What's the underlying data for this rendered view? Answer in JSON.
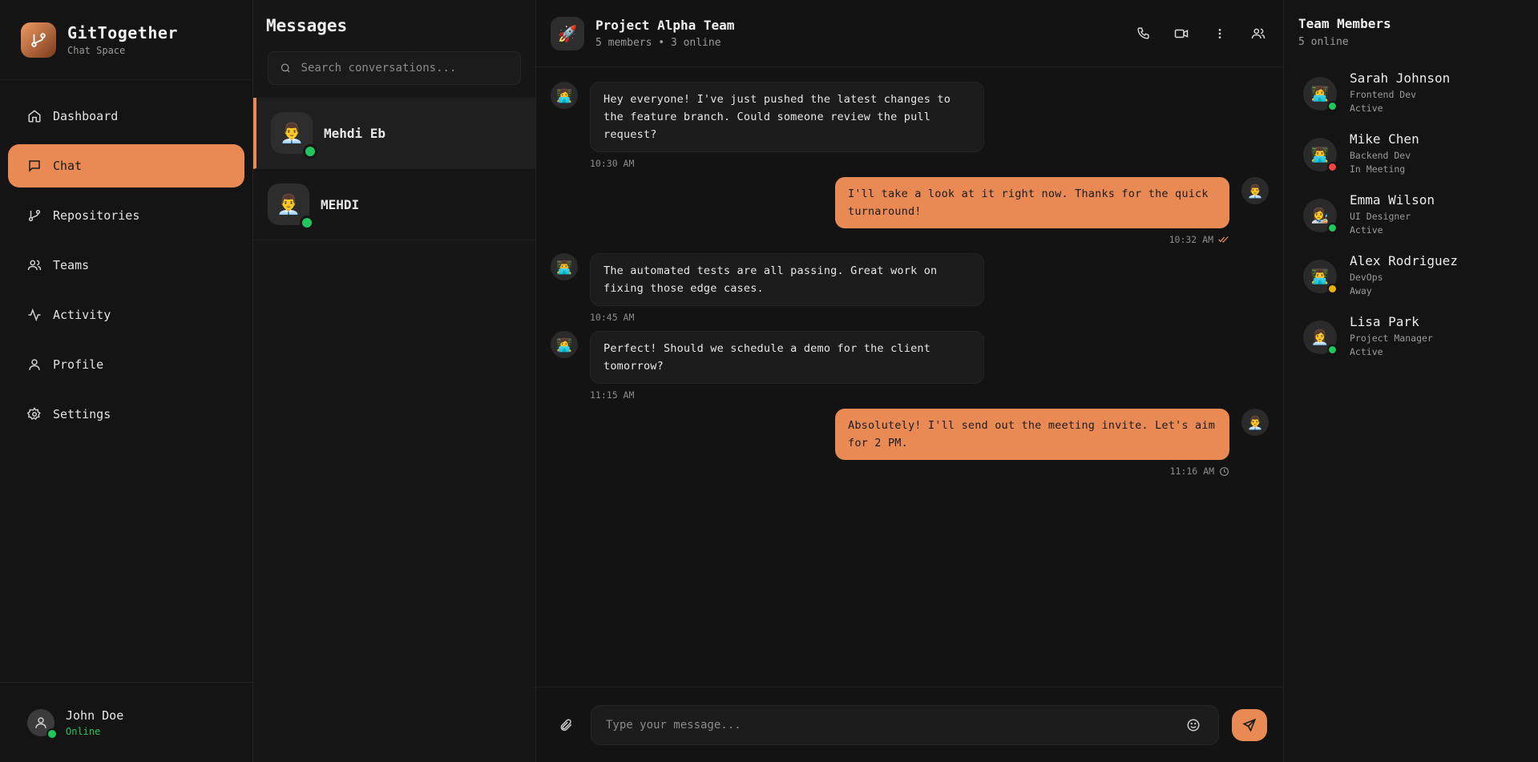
{
  "brand": {
    "title": "GitTogether",
    "subtitle": "Chat Space"
  },
  "nav": [
    {
      "label": "Dashboard",
      "icon": "home-icon"
    },
    {
      "label": "Chat",
      "icon": "message-square-icon"
    },
    {
      "label": "Repositories",
      "icon": "git-branch-icon"
    },
    {
      "label": "Teams",
      "icon": "users-icon"
    },
    {
      "label": "Activity",
      "icon": "activity-icon"
    },
    {
      "label": "Profile",
      "icon": "user-icon"
    },
    {
      "label": "Settings",
      "icon": "gear-icon"
    }
  ],
  "current_user": {
    "name": "John Doe",
    "status": "Online"
  },
  "conversations": {
    "title": "Messages",
    "search_placeholder": "Search conversations...",
    "items": [
      {
        "name": "Mehdi Eb",
        "avatar": "👨‍💼"
      },
      {
        "name": "MEHDI",
        "avatar": "👨‍💼"
      }
    ]
  },
  "chat": {
    "avatar": "🚀",
    "title": "Project Alpha Team",
    "subtitle": "5 members • 3 online",
    "composer_placeholder": "Type your message...",
    "messages": [
      {
        "dir": "in",
        "avatar": "👩‍💻",
        "text": "Hey everyone! I've just pushed the latest changes to the feature branch. Could someone review the pull request?",
        "time": "10:30 AM"
      },
      {
        "dir": "out",
        "avatar": "👨‍💼",
        "text": "I'll take a look at it right now. Thanks for the quick turnaround!",
        "time": "10:32 AM",
        "receipt": "read"
      },
      {
        "dir": "in",
        "avatar": "👨‍💻",
        "text": "The automated tests are all passing. Great work on fixing those edge cases.",
        "time": "10:45 AM"
      },
      {
        "dir": "in",
        "avatar": "👩‍💻",
        "text": "Perfect! Should we schedule a demo for the client tomorrow?",
        "time": "11:15 AM"
      },
      {
        "dir": "out",
        "avatar": "👨‍💼",
        "text": "Absolutely! I'll send out the meeting invite. Let's aim for 2 PM.",
        "time": "11:16 AM",
        "receipt": "pending"
      }
    ]
  },
  "team": {
    "title": "Team Members",
    "subtitle": "5 online",
    "members": [
      {
        "name": "Sarah Johnson",
        "role": "Frontend Dev",
        "status": "Active",
        "avatar": "👩‍💻",
        "status_color": "#22c55e"
      },
      {
        "name": "Mike Chen",
        "role": "Backend Dev",
        "status": "In Meeting",
        "avatar": "👨‍💻",
        "status_color": "#ef4444"
      },
      {
        "name": "Emma Wilson",
        "role": "UI Designer",
        "status": "Active",
        "avatar": "👩‍🎨",
        "status_color": "#22c55e"
      },
      {
        "name": "Alex Rodriguez",
        "role": "DevOps",
        "status": "Away",
        "avatar": "👨‍💻",
        "status_color": "#eab308"
      },
      {
        "name": "Lisa Park",
        "role": "Project Manager",
        "status": "Active",
        "avatar": "👩‍💼",
        "status_color": "#22c55e"
      }
    ]
  },
  "colors": {
    "accent": "#e98a55",
    "online": "#22c55e",
    "busy": "#ef4444",
    "away": "#eab308"
  }
}
